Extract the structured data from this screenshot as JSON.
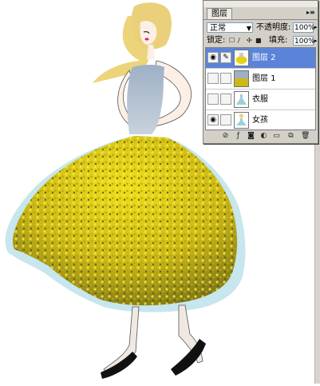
{
  "layers_panel": {
    "tab_label": "图层",
    "menu_icon": "▸≡",
    "blend_mode": "正常",
    "opacity_label": "不透明度:",
    "opacity_value": "100%",
    "lock_label": "锁定:",
    "fill_label": "填充:",
    "fill_value": "100%",
    "layers": [
      {
        "name": "图层 2",
        "visible": true,
        "selected": true
      },
      {
        "name": "图层 1",
        "visible": false,
        "selected": false
      },
      {
        "name": "衣服",
        "visible": false,
        "selected": false
      },
      {
        "name": "女孩",
        "visible": true,
        "selected": false
      }
    ]
  },
  "colors": {
    "selection": "#5b84d8",
    "panel_bg": "#d4d0c8",
    "rapeseed_yellow": "#e6d21a",
    "skirt_outline": "#bfe2ea",
    "hair": "#ecd47a"
  }
}
